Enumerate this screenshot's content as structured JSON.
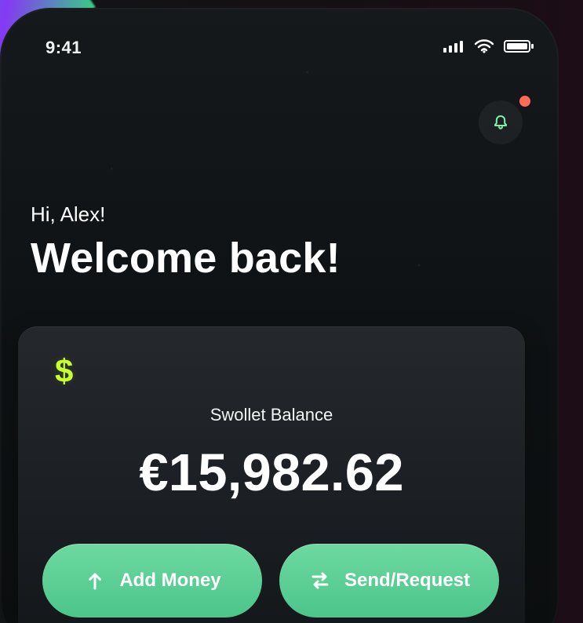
{
  "status_bar": {
    "time": "9:41"
  },
  "header": {
    "greeting": "Hi, Alex!",
    "title": "Welcome back!",
    "notification_dot": true
  },
  "balance_card": {
    "currency_icon": "dollar-sign-icon",
    "label": "Swollet Balance",
    "amount": "€15,982.62"
  },
  "actions": {
    "add_money_label": "Add Money",
    "send_request_label": "Send/Request"
  },
  "colors": {
    "accent": "#c8ff2d",
    "button": "#5fd097",
    "alert": "#ff6b57"
  }
}
